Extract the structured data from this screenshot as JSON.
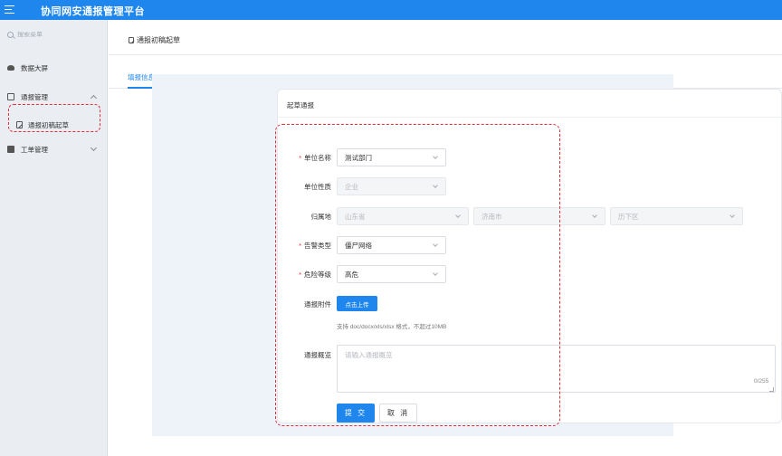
{
  "header": {
    "title": "协同网安通报管理平台"
  },
  "sidebar": {
    "search_placeholder": "搜索菜单",
    "items": [
      {
        "label": "数据大屏"
      },
      {
        "label": "通报管理"
      },
      {
        "label": "通报初稿起草"
      },
      {
        "label": "工单管理"
      }
    ]
  },
  "breadcrumb": {
    "label": "通报初稿起草"
  },
  "tabs": [
    {
      "label": "填报信息"
    }
  ],
  "card": {
    "title": "起草通报"
  },
  "form": {
    "unit_name": {
      "label": "单位名称",
      "value": "测试部门"
    },
    "unit_nature": {
      "label": "单位性质",
      "value": "企业"
    },
    "location": {
      "label": "归属地",
      "province": "山东省",
      "city": "济南市",
      "district": "历下区"
    },
    "alert_type": {
      "label": "告警类型",
      "value": "僵尸网络"
    },
    "risk_level": {
      "label": "危险等级",
      "value": "高危"
    },
    "attachment": {
      "label": "通报附件",
      "button": "点击上传",
      "hint": "支持 doc/docx/xls/xlsx 格式，不超过10MB"
    },
    "summary": {
      "label": "通报概览",
      "placeholder": "请输入通报概览",
      "counter": "0/255"
    },
    "submit": "提 交",
    "cancel": "取 消"
  },
  "colors": {
    "primary": "#1f86ee",
    "required": "#e0313b",
    "highlight": "#e0313b"
  }
}
